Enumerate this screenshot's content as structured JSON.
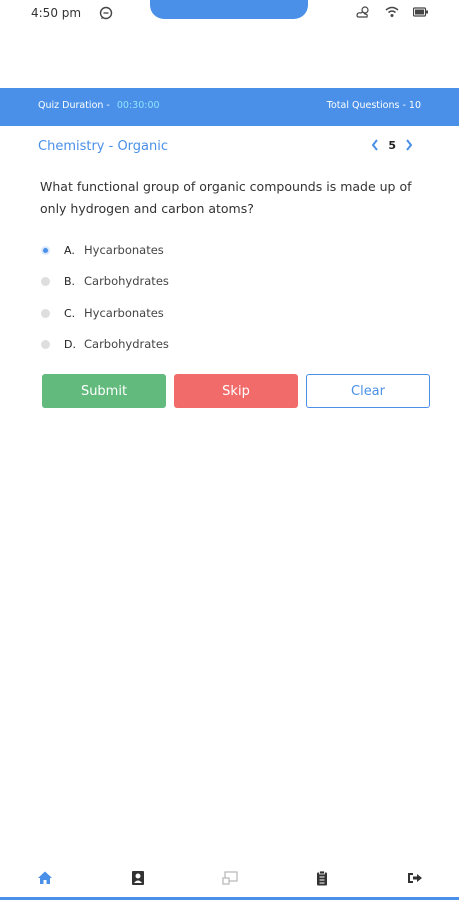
{
  "status_bar": {
    "time": "4:50 pm"
  },
  "quiz_header": {
    "duration_label": "Quiz Duration -",
    "duration_value": "00:30:00",
    "total_questions": "Total Questions - 10"
  },
  "subject": "Chemistry - Organic",
  "pager": {
    "current": "5"
  },
  "question": "What functional group of organic compounds is made up of only hydrogen and carbon atoms?",
  "options": [
    {
      "letter": "A.",
      "text": "Hycarbonates",
      "selected": true
    },
    {
      "letter": "B.",
      "text": "Carbohydrates",
      "selected": false
    },
    {
      "letter": "C.",
      "text": "Hycarbonates",
      "selected": false
    },
    {
      "letter": "D.",
      "text": "Carbohydrates",
      "selected": false
    }
  ],
  "buttons": {
    "submit": "Submit",
    "skip": "Skip",
    "clear": "Clear"
  },
  "bottom_nav": {
    "items": [
      "home-icon",
      "profile-icon",
      "screen-icon",
      "clipboard-icon",
      "logout-icon"
    ],
    "active": "home-icon"
  },
  "colors": {
    "primary": "#4a90e8",
    "timer": "#8ee3ff",
    "submit": "#62bb7d",
    "skip": "#f26b6b"
  }
}
